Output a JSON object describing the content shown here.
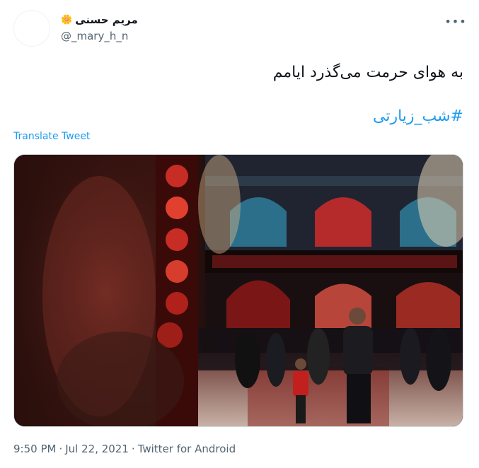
{
  "author": {
    "display_name": "مریم حسنی",
    "emoji": "🌼",
    "handle": "@_mary_h_n"
  },
  "tweet": {
    "text": "به هوای حرمت می‌گذرد ایامم",
    "hashtag": "#شب_زیارتی",
    "translate_label": "Translate Tweet"
  },
  "meta": {
    "time": "9:50 PM",
    "separator": "·",
    "date": "Jul 22, 2021",
    "source": "Twitter for Android"
  },
  "icons": {
    "more": "more-icon",
    "avatar": "avatar"
  },
  "colors": {
    "accent": "#1d9bf0",
    "text": "#0f1419",
    "secondary": "#536471"
  }
}
